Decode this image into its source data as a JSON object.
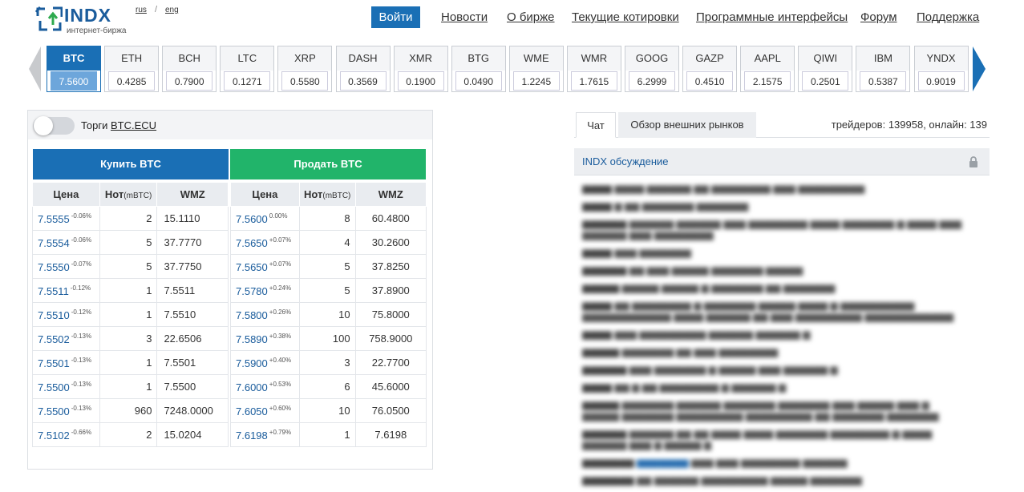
{
  "header": {
    "logo_name": "INDX",
    "logo_sub": "интернет-биржа",
    "lang_ru": "rus",
    "lang_sep": "/",
    "lang_en": "eng",
    "login": "Войти",
    "nav": [
      "Новости",
      "О бирже",
      "Текущие котировки",
      "Программные интерфейсы",
      "Форум",
      "Поддержка"
    ]
  },
  "tickers": [
    {
      "sym": "BTC",
      "px": "7.5600"
    },
    {
      "sym": "ETH",
      "px": "0.4285"
    },
    {
      "sym": "BCH",
      "px": "0.7900"
    },
    {
      "sym": "LTC",
      "px": "0.1271"
    },
    {
      "sym": "XRP",
      "px": "0.5580"
    },
    {
      "sym": "DASH",
      "px": "0.3569"
    },
    {
      "sym": "XMR",
      "px": "0.1900"
    },
    {
      "sym": "BTG",
      "px": "0.0490"
    },
    {
      "sym": "WME",
      "px": "1.2245"
    },
    {
      "sym": "WMR",
      "px": "1.7615"
    },
    {
      "sym": "GOOG",
      "px": "6.2999"
    },
    {
      "sym": "GAZP",
      "px": "0.4510"
    },
    {
      "sym": "AAPL",
      "px": "2.1575"
    },
    {
      "sym": "QIWI",
      "px": "0.2501"
    },
    {
      "sym": "IBM",
      "px": "0.5387"
    },
    {
      "sym": "YNDX",
      "px": "0.9019"
    }
  ],
  "trade": {
    "toggle_label": "Торги",
    "toggle_link": "BTC.ECU",
    "buy_label": "Купить BTC",
    "sell_label": "Продать BTC",
    "col_price": "Цена",
    "col_amount": "Нот",
    "col_amount_unit": "(mBTC)",
    "col_wmz": "WMZ",
    "buy_rows": [
      {
        "price": "7.5555",
        "chg": "-0.06%",
        "amount": "2",
        "wmz": "15.1110"
      },
      {
        "price": "7.5554",
        "chg": "-0.06%",
        "amount": "5",
        "wmz": "37.7770"
      },
      {
        "price": "7.5550",
        "chg": "-0.07%",
        "amount": "5",
        "wmz": "37.7750"
      },
      {
        "price": "7.5511",
        "chg": "-0.12%",
        "amount": "1",
        "wmz": "7.5511"
      },
      {
        "price": "7.5510",
        "chg": "-0.12%",
        "amount": "1",
        "wmz": "7.5510"
      },
      {
        "price": "7.5502",
        "chg": "-0.13%",
        "amount": "3",
        "wmz": "22.6506"
      },
      {
        "price": "7.5501",
        "chg": "-0.13%",
        "amount": "1",
        "wmz": "7.5501"
      },
      {
        "price": "7.5500",
        "chg": "-0.13%",
        "amount": "1",
        "wmz": "7.5500"
      },
      {
        "price": "7.5500",
        "chg": "-0.13%",
        "amount": "960",
        "wmz": "7248.0000"
      },
      {
        "price": "7.5102",
        "chg": "-0.66%",
        "amount": "2",
        "wmz": "15.0204"
      }
    ],
    "sell_rows": [
      {
        "price": "7.5600",
        "chg": "0.00%",
        "amount": "8",
        "wmz": "60.4800"
      },
      {
        "price": "7.5650",
        "chg": "+0.07%",
        "amount": "4",
        "wmz": "30.2600"
      },
      {
        "price": "7.5650",
        "chg": "+0.07%",
        "amount": "5",
        "wmz": "37.8250"
      },
      {
        "price": "7.5780",
        "chg": "+0.24%",
        "amount": "5",
        "wmz": "37.8900"
      },
      {
        "price": "7.5800",
        "chg": "+0.26%",
        "amount": "10",
        "wmz": "75.8000"
      },
      {
        "price": "7.5890",
        "chg": "+0.38%",
        "amount": "100",
        "wmz": "758.9000"
      },
      {
        "price": "7.5900",
        "chg": "+0.40%",
        "amount": "3",
        "wmz": "22.7700"
      },
      {
        "price": "7.6000",
        "chg": "+0.53%",
        "amount": "6",
        "wmz": "45.6000"
      },
      {
        "price": "7.6050",
        "chg": "+0.60%",
        "amount": "10",
        "wmz": "76.0500"
      },
      {
        "price": "7.6198",
        "chg": "+0.79%",
        "amount": "1",
        "wmz": "7.6198"
      }
    ]
  },
  "chat": {
    "tab_chat": "Чат",
    "tab_markets": "Обзор внешних рынков",
    "stats": "трейдеров: 139958, онлайн: 139",
    "title": "INDX обсуждение"
  },
  "colors": {
    "brand_blue": "#1a6fb5",
    "buy_green": "#21b46a",
    "logo_blue": "#1a5c9c"
  },
  "icons": [
    "indx-logo-icon",
    "lock-icon",
    "arrow-left-icon",
    "arrow-right-icon"
  ]
}
